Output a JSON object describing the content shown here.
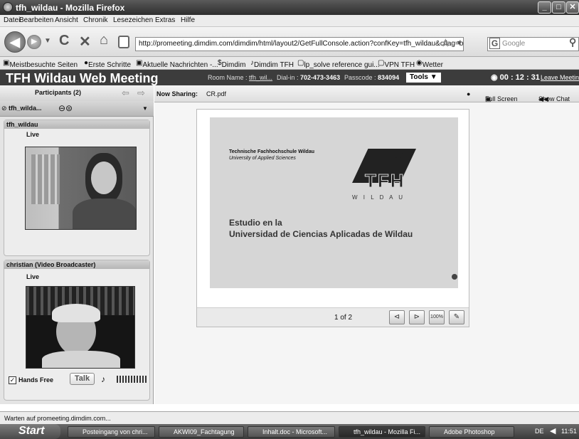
{
  "window": {
    "title": "tfh_wildau - Mozilla Firefox"
  },
  "menu": {
    "items": [
      "Datei",
      "Bearbeiten",
      "Ansicht",
      "Chronik",
      "Lesezeichen",
      "Extras",
      "Hilfe"
    ]
  },
  "nav": {
    "url": "http://promeeting.dimdim.com/dimdim/html/layout2/GetFullConsole.action?confKey=tfh_wildau&cflag=b7ymfgt",
    "search_placeholder": "Google"
  },
  "bookmarks": [
    "Meistbesuchte Seiten",
    "Erste Schritte",
    "Aktuelle Nachrichten -...",
    "Dimdim",
    "Dimdim TFH",
    "lp_solve reference gui...",
    "VPN TFH",
    "Wetter"
  ],
  "app": {
    "title": "TFH Wildau Web Meeting",
    "room_label": "Room Name :",
    "room_value": "tfh_wil...",
    "dialin_label": "Dial-in :",
    "dialin_value": "702-473-3463",
    "passcode_label": "Passcode :",
    "passcode_value": "834094",
    "tools_label": "Tools",
    "timer": "00 : 12 : 31",
    "leave_label": "Leave Meeting"
  },
  "sidebar": {
    "participants_label": "Participants (2)",
    "current_user": "tfh_wilda...",
    "panels": [
      {
        "name": "tfh_wildau",
        "status": "Live"
      },
      {
        "name": "christian (Video Broadcaster)",
        "status": "Live"
      }
    ],
    "hands_free_label": "Hands Free",
    "talk_label": "Talk"
  },
  "sharing": {
    "label": "Now Sharing:",
    "file": "CR.pdf",
    "fullscreen_label": "Full Screen",
    "show_chat_label": "Show Chat"
  },
  "slide": {
    "school_name": "Technische Fachhochschule Wildau",
    "school_sub": "University of Applied Sciences",
    "logo_text": "TFH",
    "logo_sub": "W I L D A U",
    "heading_line1": "Estudio en la",
    "heading_line2": "Universidad de Ciencias Aplicadas de Wildau"
  },
  "pager": {
    "text": "1 of 2",
    "zoom_label": "100%"
  },
  "status": {
    "text": "Warten auf promeeting.dimdim.com..."
  },
  "taskbar": {
    "start_label": "Start",
    "tasks": [
      "Posteingang von chri...",
      "AKWI09_Fachtagung",
      "Inhalt.doc - Microsoft...",
      "tfh_wildau - Mozilla Fi...",
      "Adobe Photoshop"
    ],
    "lang": "DE",
    "clock": "11:51"
  }
}
